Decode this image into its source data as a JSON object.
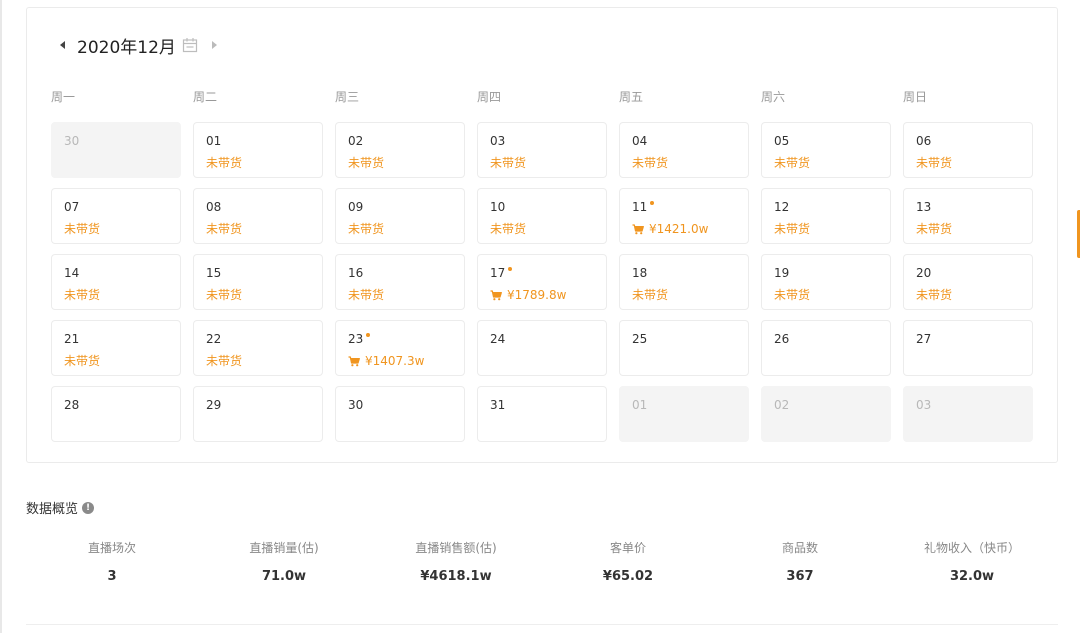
{
  "calendar": {
    "month_title": "2020年12月",
    "weekdays": [
      "周一",
      "周二",
      "周三",
      "周四",
      "周五",
      "周六",
      "周日"
    ],
    "days": [
      {
        "num": "30",
        "other": true,
        "status": ""
      },
      {
        "num": "01",
        "status": "未带货"
      },
      {
        "num": "02",
        "status": "未带货"
      },
      {
        "num": "03",
        "status": "未带货"
      },
      {
        "num": "04",
        "status": "未带货"
      },
      {
        "num": "05",
        "status": "未带货"
      },
      {
        "num": "06",
        "status": "未带货"
      },
      {
        "num": "07",
        "status": "未带货"
      },
      {
        "num": "08",
        "status": "未带货"
      },
      {
        "num": "09",
        "status": "未带货"
      },
      {
        "num": "10",
        "status": "未带货"
      },
      {
        "num": "11",
        "live": true,
        "cart": true,
        "status": "¥1421.0w"
      },
      {
        "num": "12",
        "status": "未带货"
      },
      {
        "num": "13",
        "status": "未带货"
      },
      {
        "num": "14",
        "status": "未带货"
      },
      {
        "num": "15",
        "status": "未带货"
      },
      {
        "num": "16",
        "status": "未带货"
      },
      {
        "num": "17",
        "live": true,
        "cart": true,
        "status": "¥1789.8w"
      },
      {
        "num": "18",
        "status": "未带货"
      },
      {
        "num": "19",
        "status": "未带货"
      },
      {
        "num": "20",
        "status": "未带货"
      },
      {
        "num": "21",
        "status": "未带货"
      },
      {
        "num": "22",
        "status": "未带货"
      },
      {
        "num": "23",
        "live": true,
        "cart": true,
        "status": "¥1407.3w"
      },
      {
        "num": "24",
        "status": ""
      },
      {
        "num": "25",
        "status": ""
      },
      {
        "num": "26",
        "status": ""
      },
      {
        "num": "27",
        "status": ""
      },
      {
        "num": "28",
        "status": ""
      },
      {
        "num": "29",
        "status": ""
      },
      {
        "num": "30",
        "status": ""
      },
      {
        "num": "31",
        "status": ""
      },
      {
        "num": "01",
        "other": true,
        "status": ""
      },
      {
        "num": "02",
        "other": true,
        "status": ""
      },
      {
        "num": "03",
        "other": true,
        "status": ""
      }
    ]
  },
  "overview": {
    "title": "数据概览",
    "stats": [
      {
        "label": "直播场次",
        "value": "3"
      },
      {
        "label": "直播销量(估)",
        "value": "71.0w"
      },
      {
        "label": "直播销售额(估)",
        "value": "¥4618.1w"
      },
      {
        "label": "客单价",
        "value": "¥65.02"
      },
      {
        "label": "商品数",
        "value": "367"
      },
      {
        "label": "礼物收入（快币）",
        "value": "32.0w"
      }
    ]
  },
  "colors": {
    "accent": "#f0951f",
    "muted": "#999999",
    "other_day_bg": "#f4f4f4"
  },
  "icons": {
    "prev": "caret-left-icon",
    "next": "caret-right-icon",
    "calendar": "calendar-icon",
    "cart": "cart-icon",
    "info": "info-icon"
  }
}
